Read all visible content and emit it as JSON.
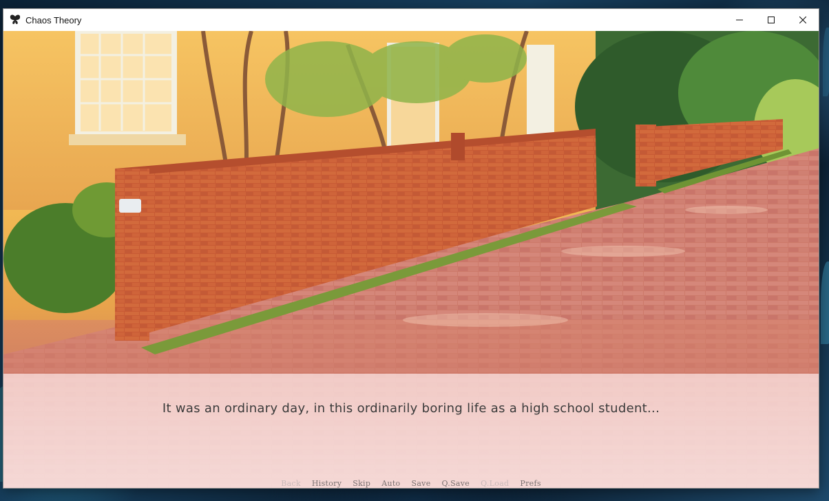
{
  "window": {
    "title": "Chaos Theory",
    "icon": "butterfly-icon"
  },
  "controls": {
    "minimize_icon": "minimize-icon",
    "maximize_icon": "maximize-icon",
    "close_icon": "close-icon"
  },
  "scene": {
    "description_icon": "background-scene"
  },
  "dialogue": {
    "text": "It was an ordinary day, in this ordinarily boring life as a high school student..."
  },
  "quick_menu": [
    {
      "label": "Back",
      "enabled": false
    },
    {
      "label": "History",
      "enabled": true
    },
    {
      "label": "Skip",
      "enabled": true
    },
    {
      "label": "Auto",
      "enabled": true
    },
    {
      "label": "Save",
      "enabled": true
    },
    {
      "label": "Q.Save",
      "enabled": true
    },
    {
      "label": "Q.Load",
      "enabled": false
    },
    {
      "label": "Prefs",
      "enabled": true
    }
  ],
  "colors": {
    "textbox_bg": "#ffeaea",
    "dialogue_text": "#3a3a3a",
    "menu_text": "#7a7070",
    "menu_disabled": "#c9b9b9"
  }
}
